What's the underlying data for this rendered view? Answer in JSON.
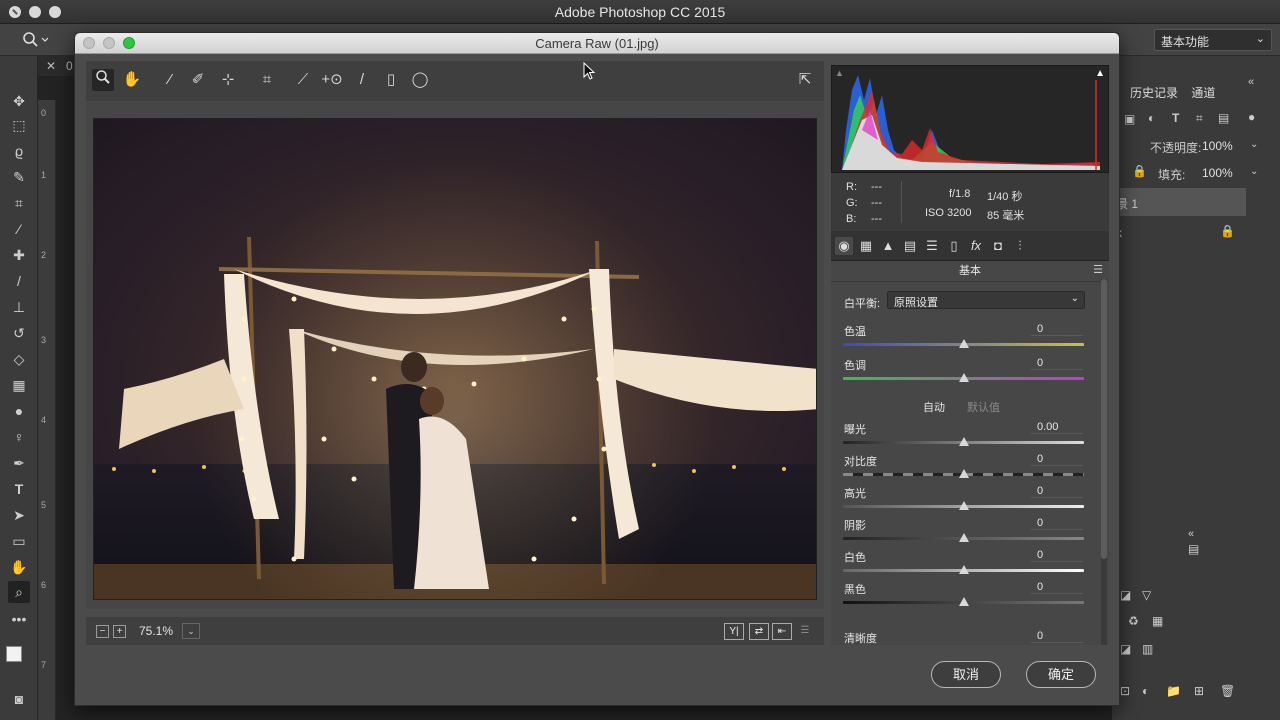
{
  "app": {
    "title": "Adobe Photoshop CC 2015",
    "workspace": "基本功能",
    "doc_tab_label": "0",
    "ruler_marks": [
      "0",
      "1",
      "2",
      "3",
      "4",
      "5",
      "6",
      "7"
    ]
  },
  "ps_right": {
    "tabs": [
      "历史记录",
      "通道"
    ],
    "opacity_label": "不透明度:",
    "opacity_value": "100%",
    "fill_label": "填充:",
    "fill_value": "100%",
    "layer_1": "景 1",
    "layer_2": "k"
  },
  "dialog": {
    "title": "Camera Raw (01.jpg)",
    "zoom_level": "75.1%",
    "cancel_label": "取消",
    "ok_label": "确定"
  },
  "toolbar_icons": [
    "zoom-icon",
    "hand-icon",
    "white-balance-icon",
    "color-sampler-icon",
    "targeted-adjustment-icon",
    "crop-icon",
    "straighten-icon",
    "spot-removal-icon",
    "red-eye-icon",
    "adjustment-brush-icon",
    "graduated-filter-icon",
    "radial-filter-icon"
  ],
  "view_buttons": [
    "Y|",
    "⇄",
    "⇤"
  ],
  "info": {
    "r_label": "R:",
    "r_value": "---",
    "g_label": "G:",
    "g_value": "---",
    "b_label": "B:",
    "b_value": "---",
    "aperture": "f/1.8",
    "shutter": "1/40 秒",
    "iso": "ISO 3200",
    "focal": "85 毫米"
  },
  "panel": {
    "title": "基本",
    "wb_label": "白平衡:",
    "wb_value": "原照设置",
    "auto_label": "自动",
    "default_label": "默认值",
    "sliders": [
      {
        "label": "色温",
        "value": "0"
      },
      {
        "label": "色调",
        "value": "0"
      },
      {
        "label": "曝光",
        "value": "0.00"
      },
      {
        "label": "对比度",
        "value": "0"
      },
      {
        "label": "高光",
        "value": "0"
      },
      {
        "label": "阴影",
        "value": "0"
      },
      {
        "label": "白色",
        "value": "0"
      },
      {
        "label": "黑色",
        "value": "0"
      },
      {
        "label": "清晰度",
        "value": "0"
      }
    ]
  },
  "colors": {
    "temp_gradient_start": "#3d48c8",
    "temp_gradient_end": "#c8c43d",
    "tint_gradient_start": "#3dbd4c",
    "tint_gradient_end": "#c03dc8",
    "accent_green": "#2fc540"
  }
}
